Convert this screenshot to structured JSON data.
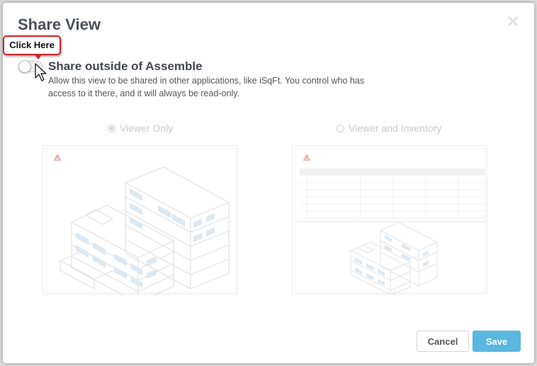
{
  "modal": {
    "title": "Share View",
    "close_icon": "close-icon"
  },
  "callout": {
    "label": "Click Here",
    "border_color": "#d2232a"
  },
  "share": {
    "title": "Share outside of Assemble",
    "description": "Allow this view to be shared in other applications, like iSqFt. You control who has access to it there, and it will always be read-only.",
    "toggle_on": false
  },
  "options": [
    {
      "label": "Viewer Only",
      "selected": true,
      "enabled": false
    },
    {
      "label": "Viewer and Inventory",
      "selected": false,
      "enabled": false
    }
  ],
  "previews": {
    "viewer": {
      "logo_icon": "assemble-logo-icon",
      "illustration": "building-illustration"
    },
    "inventory": {
      "logo_icon": "assemble-logo-icon",
      "illustration": "building-illustration",
      "has_grid": true
    }
  },
  "footer": {
    "cancel_label": "Cancel",
    "save_label": "Save"
  },
  "colors": {
    "accent": "#5ab7df",
    "title_text": "#4b4f57",
    "disabled_text": "#c9c9c9"
  }
}
